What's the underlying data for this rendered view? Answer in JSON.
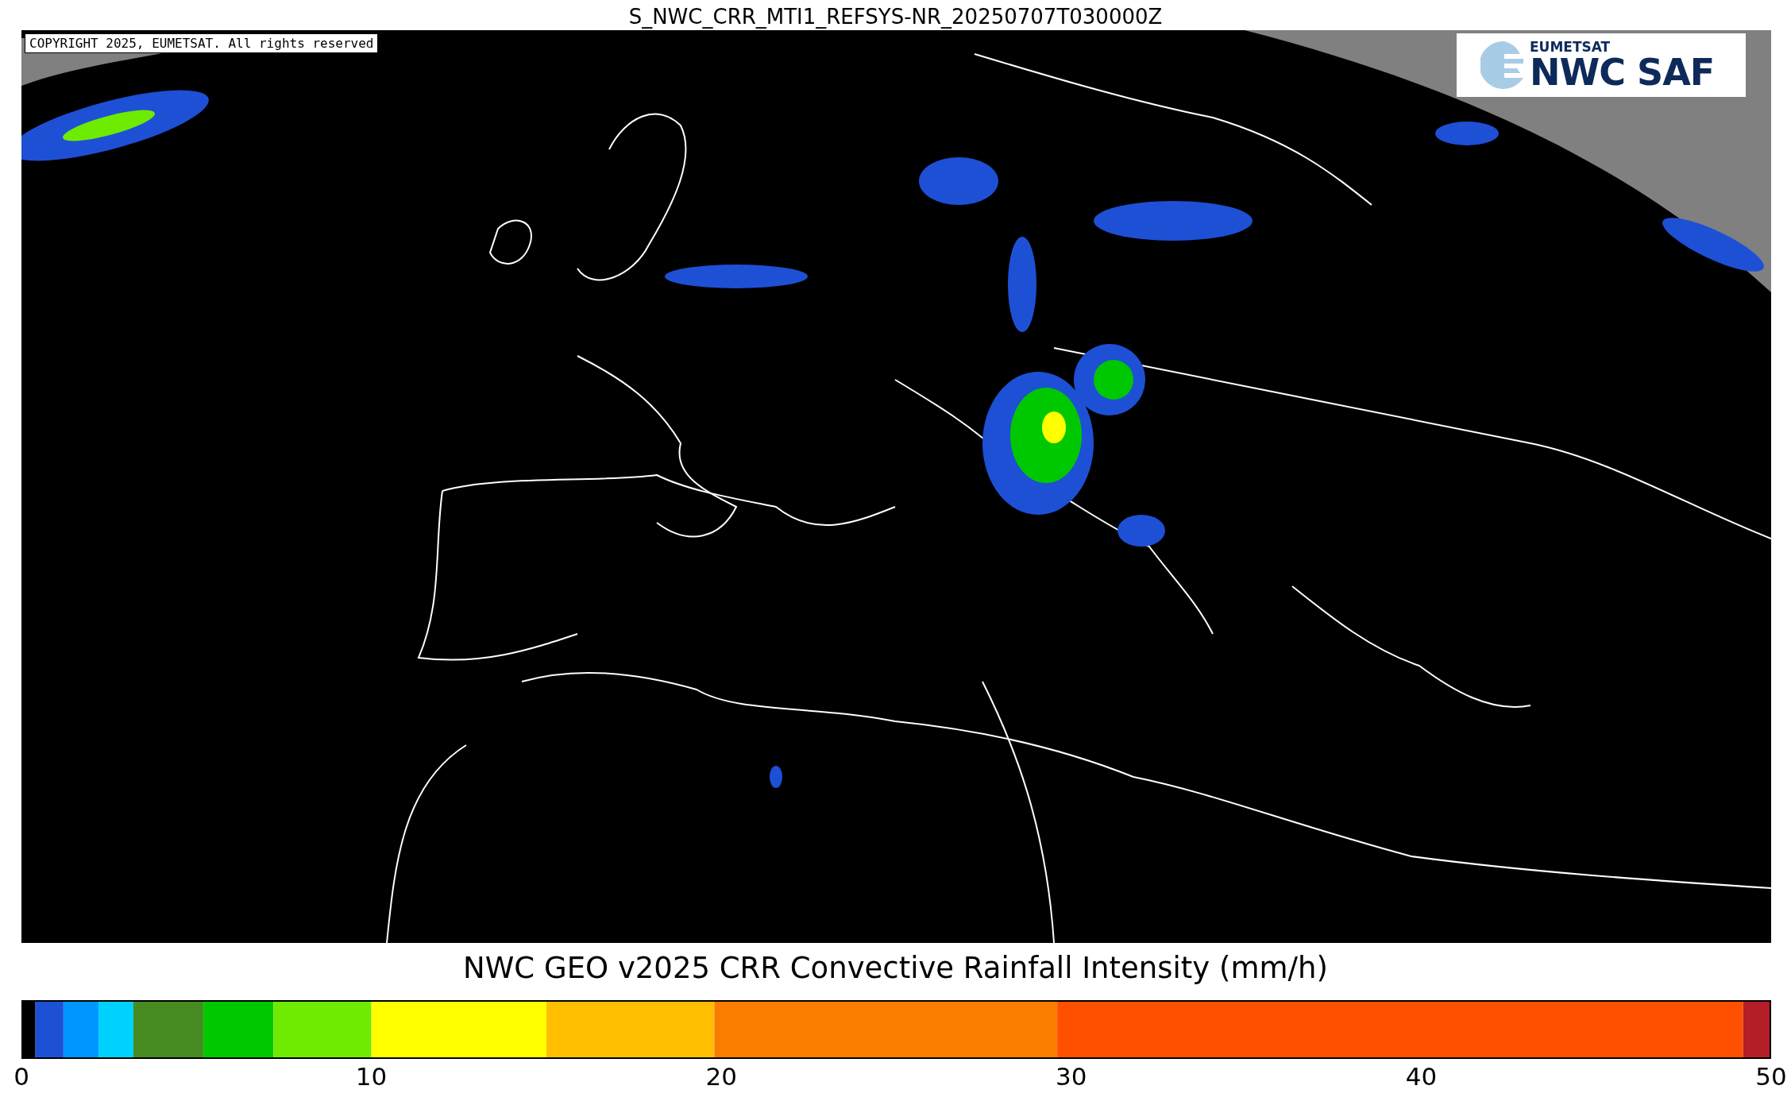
{
  "title": "S_NWC_CRR_MTI1_REFSYS-NR_20250707T030000Z",
  "map": {
    "copyright": "COPYRIGHT 2025, EUMETSAT. All rights reserved",
    "logo": {
      "top": "EUMETSAT",
      "main": "NWC SAF"
    }
  },
  "colorbar": {
    "chart_data": {
      "type": "bar",
      "orientation": "horizontal",
      "stacked": true,
      "title": "NWC GEO v2025 CRR Convective Rainfall Intensity (mm/h)",
      "xlim": [
        0,
        50
      ],
      "xticks": [
        0,
        10,
        20,
        30,
        40,
        50
      ],
      "series": [
        {
          "color": "#000000",
          "values": [
            0.4
          ]
        },
        {
          "color": "#1e50d6",
          "values": [
            0.8
          ]
        },
        {
          "color": "#0096ff",
          "values": [
            1.0
          ]
        },
        {
          "color": "#00d2ff",
          "values": [
            1.0
          ]
        },
        {
          "color": "#468c23",
          "values": [
            2.0
          ]
        },
        {
          "color": "#00c800",
          "values": [
            2.0
          ]
        },
        {
          "color": "#6eeb00",
          "values": [
            2.8
          ]
        },
        {
          "color": "#ffff00",
          "values": [
            5.0
          ]
        },
        {
          "color": "#ffbe00",
          "values": [
            4.8
          ]
        },
        {
          "color": "#fa7d00",
          "values": [
            9.8
          ]
        },
        {
          "color": "#ff5000",
          "values": [
            19.6
          ]
        },
        {
          "color": "#b41e28",
          "values": [
            0.8
          ]
        }
      ]
    }
  }
}
